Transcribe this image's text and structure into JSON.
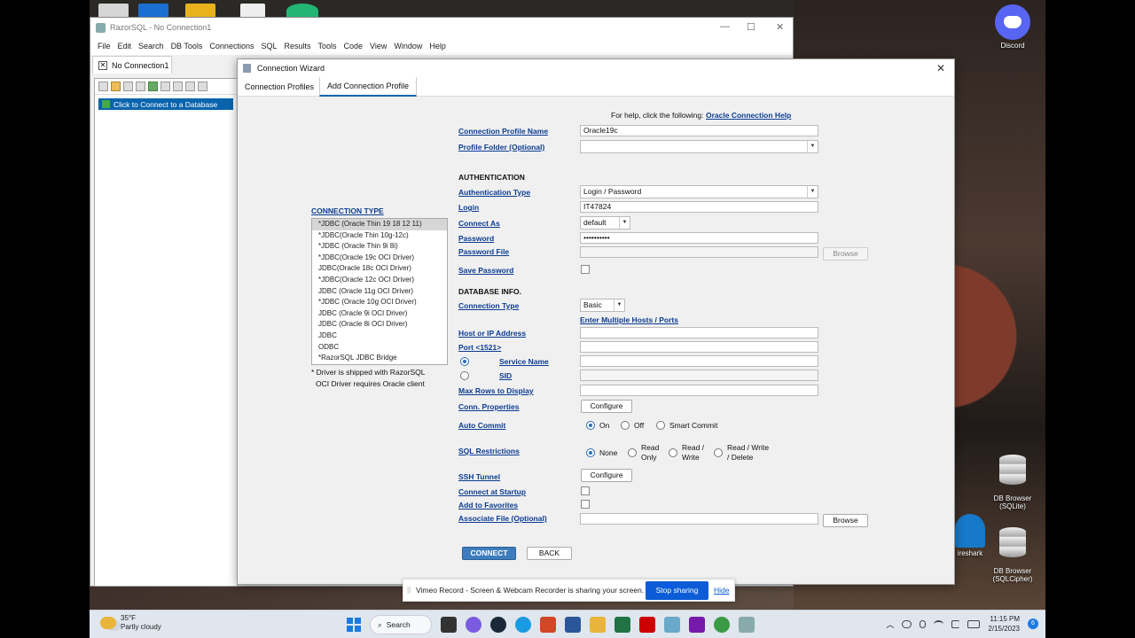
{
  "razorsql": {
    "title": "RazorSQL - No Connection1",
    "menu": [
      "File",
      "Edit",
      "Search",
      "DB Tools",
      "Connections",
      "SQL",
      "Results",
      "Tools",
      "Code",
      "View",
      "Window",
      "Help"
    ],
    "tab": "No Connection1",
    "tree_item": "Click to Connect to a Database"
  },
  "wizard": {
    "title": "Connection Wizard",
    "tabs": [
      "Connection Profiles",
      "Add Connection Profile"
    ],
    "help_prefix": "For help, click the following:",
    "help_link": "Oracle Connection Help",
    "profile_name_label": "Connection Profile Name",
    "profile_name_value": "Oracle19c",
    "profile_folder_label": "Profile Folder (Optional)",
    "authentication_heading": "AUTHENTICATION",
    "auth_type_label": "Authentication Type",
    "auth_type_value": "Login / Password",
    "login_label": "Login",
    "login_value": "IT47824",
    "connect_as_label": "Connect As",
    "connect_as_value": "default",
    "password_label": "Password",
    "password_value": "••••••••••",
    "password_file_label": "Password File",
    "browse": "Browse",
    "save_password_label": "Save Password",
    "database_info_heading": "DATABASE INFO.",
    "connection_type_label": "Connection Type",
    "connection_type_value": "Basic",
    "multiple_hosts_link": "Enter Multiple Hosts / Ports",
    "host_label": "Host or IP Address",
    "port_label": "Port <1521>",
    "service_name_label": "Service Name",
    "sid_label": "SID",
    "max_rows_label": "Max Rows to Display",
    "conn_properties_label": "Conn. Properties",
    "configure": "Configure",
    "auto_commit_label": "Auto Commit",
    "auto_commit_options": [
      "On",
      "Off",
      "Smart Commit"
    ],
    "sql_restrictions_label": "SQL Restrictions",
    "sql_restrictions_options": [
      "None",
      "Read\nOnly",
      "Read /\nWrite",
      "Read / Write\n/ Delete"
    ],
    "ssh_tunnel_label": "SSH Tunnel",
    "connect_at_startup_label": "Connect at Startup",
    "add_to_favorites_label": "Add to Favorites",
    "associate_file_label": "Associate File (Optional)",
    "connect_button": "CONNECT",
    "back_button": "BACK",
    "connection_type_heading": "CONNECTION TYPE",
    "drivers": [
      "*JDBC (Oracle Thin 19 18 12 11)",
      "*JDBC(Oracle Thin 10g-12c)",
      "*JDBC (Oracle Thin 9i 8i)",
      "*JDBC(Oracle 19c OCI Driver)",
      "JDBC(Oracle 18c OCI Driver)",
      "*JDBC(Oracle 12c OCI Driver)",
      "JDBC (Oracle 11g OCI Driver)",
      "*JDBC (Oracle 10g OCI Driver)",
      "JDBC (Oracle 9i OCI Driver)",
      "JDBC (Oracle 8i OCI Driver)",
      "JDBC",
      "ODBC",
      "*RazorSQL JDBC Bridge"
    ],
    "driver_note_1": "* Driver is shipped with RazorSQL",
    "driver_note_2": "OCI Driver requires Oracle client"
  },
  "notification": {
    "message": "Vimeo Record - Screen & Webcam Recorder is sharing your screen.",
    "stop_button": "Stop sharing",
    "hide_link": "Hide"
  },
  "desktop": {
    "discord": "Discord",
    "db_browser_sqlite": "DB Browser\n(SQLite)",
    "db_browser_sqlcipher": "DB Browser\n(SQLCipher)",
    "wireshark_partial": "ireshark"
  },
  "taskbar": {
    "temperature": "35°F",
    "weather": "Partly cloudy",
    "search": "Search",
    "time": "11:15 PM",
    "date": "2/15/2023",
    "notification_count": "6"
  },
  "colors": {
    "accent": "#0a64ad",
    "link": "#0b3c91",
    "stop_button": "#0b5cd6",
    "connect_button": "#3d7dbd"
  }
}
